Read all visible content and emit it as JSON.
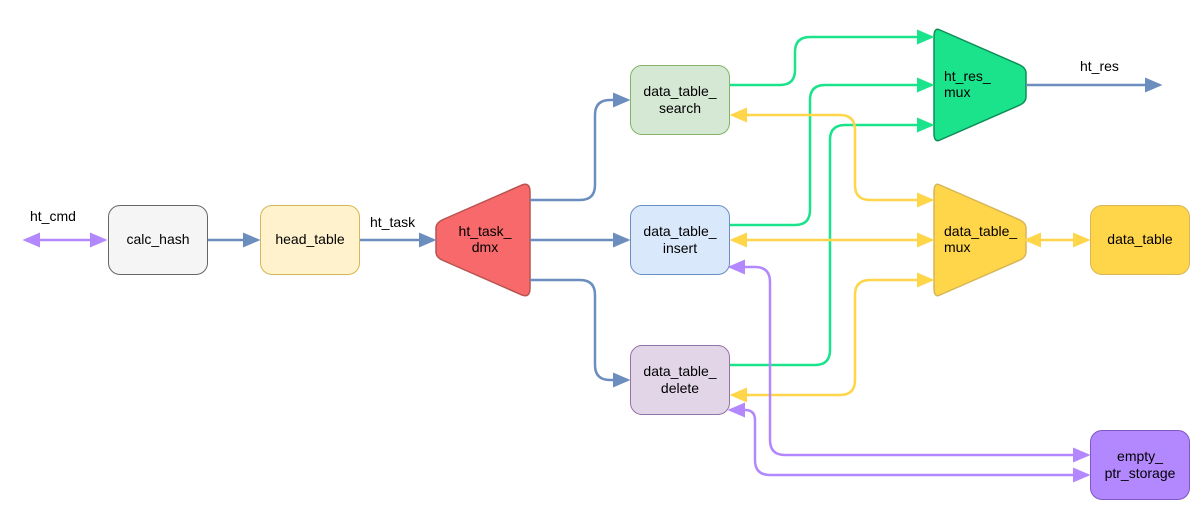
{
  "labels": {
    "ht_cmd": "ht_cmd",
    "ht_task": "ht_task",
    "ht_res": "ht_res"
  },
  "nodes": {
    "calc_hash": "calc_hash",
    "head_table": "head_table",
    "ht_task_dmx": "ht_task_\ndmx",
    "data_table_search": "data_table_\nsearch",
    "data_table_insert": "data_table_\ninsert",
    "data_table_delete": "data_table_\ndelete",
    "ht_res_mux": "ht_res_\nmux",
    "data_table_mux": "data_table_\nmux",
    "data_table": "data_table",
    "empty_ptr_storage": "empty_\nptr_storage"
  },
  "colors": {
    "gray_fill": "#F5F5F5",
    "gray_stroke": "#666666",
    "cream_fill": "#FFF2CC",
    "cream_stroke": "#D6B656",
    "red_fill": "#F8696B",
    "red_stroke": "#B85450",
    "green_node_fill": "#D5E8D4",
    "green_node_stroke": "#82B366",
    "blue_node_fill": "#DAE8FC",
    "blue_node_stroke": "#6C8EBF",
    "purple_node_fill": "#E1D5E7",
    "purple_node_stroke": "#9673A6",
    "emerald_fill": "#1BE38B",
    "emerald_stroke": "#0E8E57",
    "yellow_fill": "#FFD54A",
    "yellow_stroke": "#D6B656",
    "violet_fill": "#B388FF",
    "violet_stroke": "#7E57C2",
    "arrow_blue": "#6C8EBF",
    "arrow_green": "#1BE38B",
    "arrow_yellow": "#FFD54A",
    "arrow_violet": "#B388FF"
  },
  "chart_data": {
    "type": "block-diagram",
    "nodes": [
      {
        "id": "calc_hash",
        "label": "calc_hash",
        "shape": "rounded-rect",
        "color": "gray"
      },
      {
        "id": "head_table",
        "label": "head_table",
        "shape": "rounded-rect",
        "color": "cream"
      },
      {
        "id": "ht_task_dmx",
        "label": "ht_task_dmx",
        "shape": "demux-trapezoid",
        "color": "red"
      },
      {
        "id": "data_table_search",
        "label": "data_table_search",
        "shape": "rounded-rect",
        "color": "green"
      },
      {
        "id": "data_table_insert",
        "label": "data_table_insert",
        "shape": "rounded-rect",
        "color": "blue"
      },
      {
        "id": "data_table_delete",
        "label": "data_table_delete",
        "shape": "rounded-rect",
        "color": "purple"
      },
      {
        "id": "ht_res_mux",
        "label": "ht_res_mux",
        "shape": "mux-trapezoid",
        "color": "emerald"
      },
      {
        "id": "data_table_mux",
        "label": "data_table_mux",
        "shape": "mux-trapezoid",
        "color": "yellow"
      },
      {
        "id": "data_table",
        "label": "data_table",
        "shape": "rounded-rect",
        "color": "yellow"
      },
      {
        "id": "empty_ptr_storage",
        "label": "empty_ptr_storage",
        "shape": "rounded-rect",
        "color": "violet"
      }
    ],
    "edges": [
      {
        "from": "external_left",
        "to": "calc_hash",
        "label": "ht_cmd",
        "color": "violet",
        "direction": "bi"
      },
      {
        "from": "calc_hash",
        "to": "head_table",
        "color": "blue",
        "direction": "uni"
      },
      {
        "from": "head_table",
        "to": "ht_task_dmx",
        "label": "ht_task",
        "color": "blue",
        "direction": "uni"
      },
      {
        "from": "ht_task_dmx",
        "to": "data_table_search",
        "color": "blue",
        "direction": "uni"
      },
      {
        "from": "ht_task_dmx",
        "to": "data_table_insert",
        "color": "blue",
        "direction": "uni"
      },
      {
        "from": "ht_task_dmx",
        "to": "data_table_delete",
        "color": "blue",
        "direction": "uni"
      },
      {
        "from": "data_table_search",
        "to": "ht_res_mux",
        "color": "green",
        "direction": "uni"
      },
      {
        "from": "data_table_insert",
        "to": "ht_res_mux",
        "color": "green",
        "direction": "uni"
      },
      {
        "from": "data_table_delete",
        "to": "ht_res_mux",
        "color": "green",
        "direction": "uni"
      },
      {
        "from": "ht_res_mux",
        "to": "external_right",
        "label": "ht_res",
        "color": "blue",
        "direction": "uni"
      },
      {
        "from": "data_table_search",
        "to": "data_table_mux",
        "color": "yellow",
        "direction": "bi"
      },
      {
        "from": "data_table_insert",
        "to": "data_table_mux",
        "color": "yellow",
        "direction": "bi"
      },
      {
        "from": "data_table_delete",
        "to": "data_table_mux",
        "color": "yellow",
        "direction": "bi"
      },
      {
        "from": "data_table_mux",
        "to": "data_table",
        "color": "yellow",
        "direction": "bi"
      },
      {
        "from": "data_table_insert",
        "to": "empty_ptr_storage",
        "color": "violet",
        "direction": "bi"
      },
      {
        "from": "data_table_delete",
        "to": "empty_ptr_storage",
        "color": "violet",
        "direction": "bi"
      }
    ]
  }
}
